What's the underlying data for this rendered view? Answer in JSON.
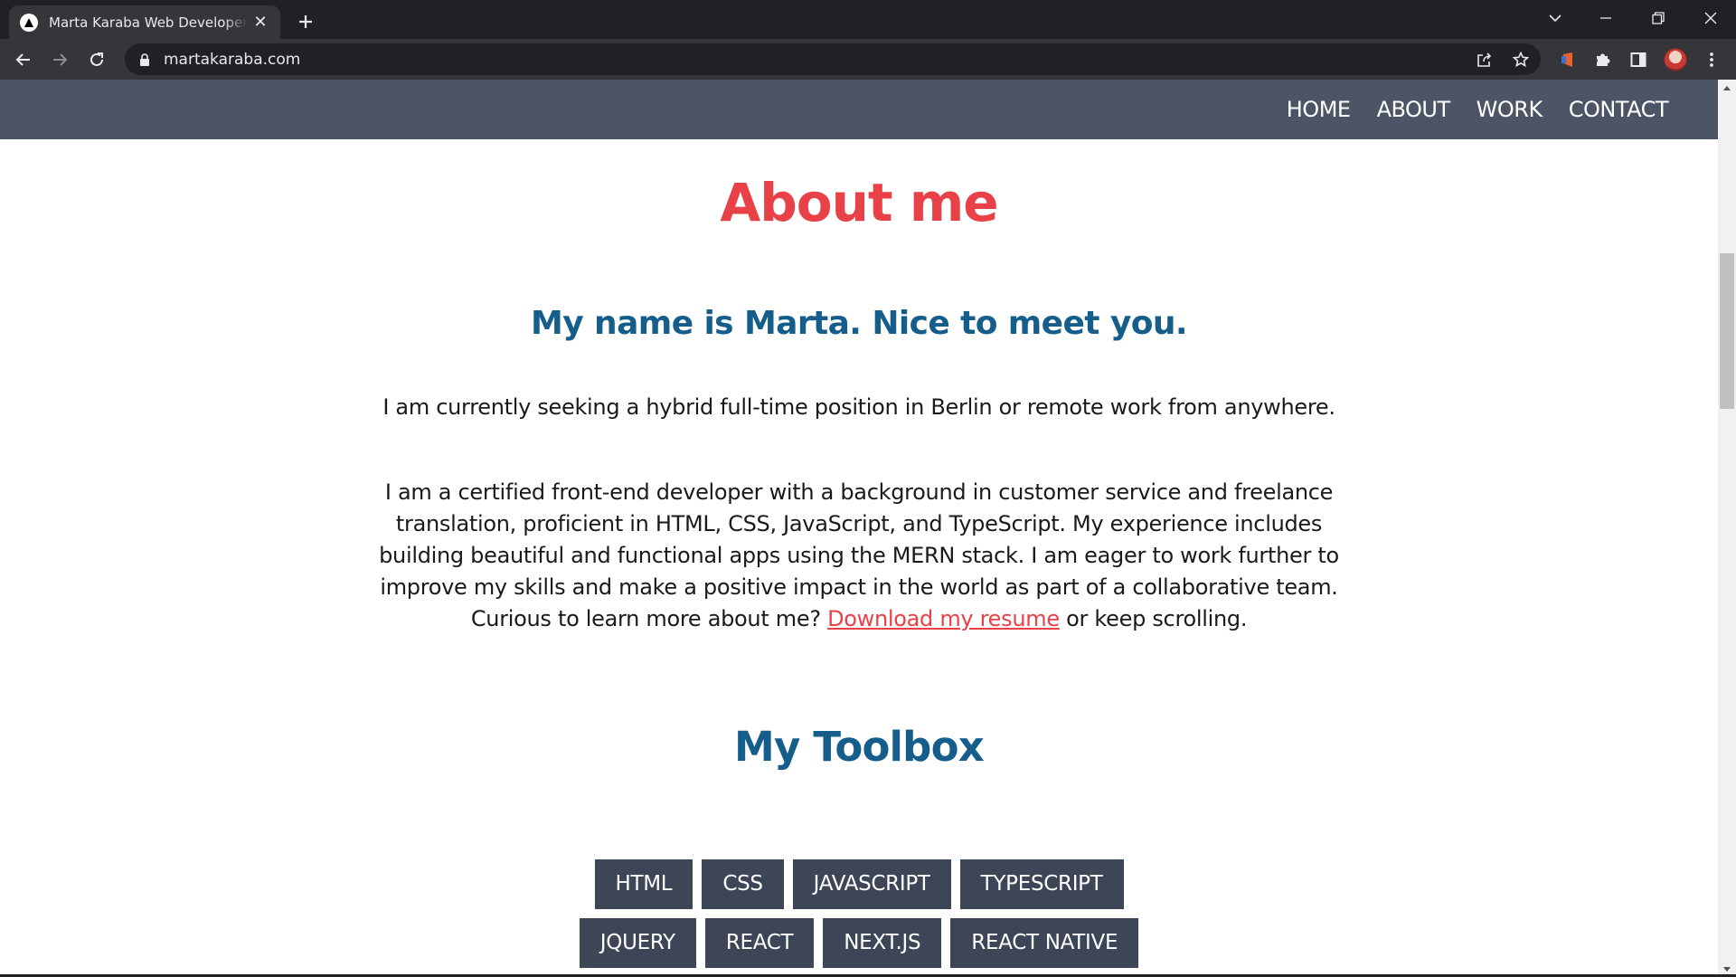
{
  "browser": {
    "tab_title": "Marta Karaba Web Developer Portfolio",
    "url": "martakaraba.com",
    "tab_close_glyph": "✕",
    "icons": [
      "favicon-icon",
      "close-icon",
      "plus-icon",
      "chevron-down-icon",
      "minimize-icon",
      "restore-icon",
      "window-close-icon",
      "back-icon",
      "forward-icon",
      "reload-icon",
      "lock-icon",
      "share-icon",
      "star-icon",
      "extension-icon",
      "puzzle-icon",
      "side-panel-icon",
      "avatar",
      "more-icon"
    ]
  },
  "nav": {
    "items": [
      "HOME",
      "ABOUT",
      "WORK",
      "CONTACT"
    ]
  },
  "about": {
    "title": "About me",
    "subtitle": "My name is Marta. Nice to meet you.",
    "seeking": "I am currently seeking a hybrid full-time position in Berlin or remote work from anywhere.",
    "bio_before": "I am a certified front-end developer with a background in customer service and freelance translation, proficient in HTML, CSS, JavaScript, and TypeScript. My experience includes building beautiful and functional apps using the MERN stack. I am eager to work further to improve my skills and make a positive impact in the world as part of a collaborative team. Curious to learn more about me? ",
    "resume_link": "Download my resume",
    "bio_after": " or keep scrolling."
  },
  "toolbox": {
    "title": "My Toolbox",
    "rows": [
      [
        "HTML",
        "CSS",
        "JAVASCRIPT",
        "TYPESCRIPT"
      ],
      [
        "JQUERY",
        "REACT",
        "NEXT.JS",
        "REACT NATIVE"
      ]
    ]
  },
  "colors": {
    "accent_red": "#e84147",
    "heading_blue": "#155e8c",
    "nav_bg": "#4b5565",
    "chip_bg": "#3d4657"
  }
}
